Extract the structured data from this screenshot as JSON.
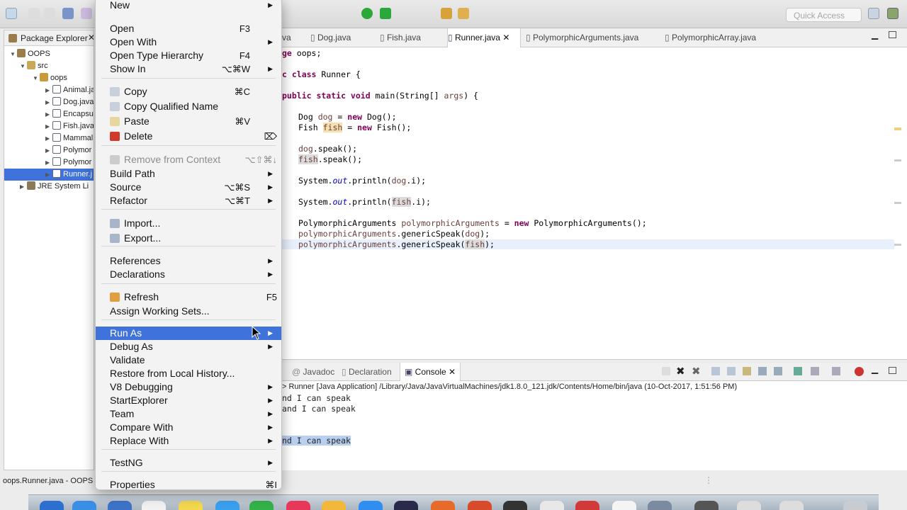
{
  "toolbar": {
    "quick_access_placeholder": "Quick Access"
  },
  "package_explorer": {
    "title": "Package Explorer",
    "tree": [
      {
        "label": "OOPS",
        "indent": 0,
        "kind": "project"
      },
      {
        "label": "src",
        "indent": 1,
        "kind": "folder"
      },
      {
        "label": "oops",
        "indent": 2,
        "kind": "package"
      },
      {
        "label": "Animal.ja",
        "indent": 3,
        "kind": "java"
      },
      {
        "label": "Dog.java",
        "indent": 3,
        "kind": "java"
      },
      {
        "label": "Encapsu",
        "indent": 3,
        "kind": "java"
      },
      {
        "label": "Fish.java",
        "indent": 3,
        "kind": "java"
      },
      {
        "label": "Mammal",
        "indent": 3,
        "kind": "java"
      },
      {
        "label": "Polymor",
        "indent": 3,
        "kind": "java"
      },
      {
        "label": "Polymor",
        "indent": 3,
        "kind": "java"
      },
      {
        "label": "Runner.j",
        "indent": 3,
        "kind": "java",
        "selected": true
      },
      {
        "label": "JRE System Li",
        "indent": 1,
        "kind": "library"
      }
    ]
  },
  "editor": {
    "tabs": [
      "va",
      "Dog.java",
      "Fish.java",
      "Runner.java",
      "PolymorphicArguments.java",
      "PolymorphicArray.java"
    ],
    "active_tab": "Runner.java",
    "lines": {
      "l1a": "ge ",
      "l1b": "oops;",
      "l2a": "c class",
      "l2b": " Runner {",
      "l3a": "public static void",
      "l3b": " main(String[] ",
      "l3c": "args",
      "l3d": ") {",
      "l4a": "Dog ",
      "l4b": "dog",
      "l4c": " = ",
      "l4d": "new",
      "l4e": " Dog();",
      "l5a": "Fish ",
      "l5b": "fish",
      "l5c": " = ",
      "l5d": "new",
      "l5e": " Fish();",
      "l6a": "dog",
      "l6b": ".speak();",
      "l7a": "fish",
      "l7b": ".speak();",
      "l8a": "System.",
      "l8b": "out",
      "l8c": ".println(",
      "l8d": "dog",
      "l8e": ".i);",
      "l9a": "System.",
      "l9b": "out",
      "l9c": ".println(",
      "l9d": "fish",
      "l9e": ".i);",
      "l10a": "PolymorphicArguments ",
      "l10b": "polymorphicArguments",
      "l10c": " = ",
      "l10d": "new",
      "l10e": " PolymorphicArguments();",
      "l11a": "polymorphicArguments",
      "l11b": ".genericSpeak(",
      "l11c": "dog",
      "l11d": ");",
      "l12a": "polymorphicArguments",
      "l12b": ".genericSpeak(",
      "l12c": "fish",
      "l12d": ");"
    }
  },
  "console": {
    "tabs": [
      "Javadoc",
      "Declaration",
      "Console"
    ],
    "header": "> Runner [Java Application] /Library/Java/JavaVirtualMachines/jdk1.8.0_121.jdk/Contents/Home/bin/java (10-Oct-2017, 1:51:56 PM)",
    "lines": [
      "nd I can speak",
      "and I can speak",
      "nd I can speak"
    ]
  },
  "status": {
    "text": "oops.Runner.java - OOPS"
  },
  "context_menu": {
    "items": {
      "new": {
        "label": "New"
      },
      "open": {
        "label": "Open",
        "shortcut": "F3"
      },
      "open_with": {
        "label": "Open With"
      },
      "open_type_hierarchy": {
        "label": "Open Type Hierarchy",
        "shortcut": "F4"
      },
      "show_in": {
        "label": "Show In",
        "shortcut": "⌥⌘W"
      },
      "copy": {
        "label": "Copy",
        "shortcut": "⌘C"
      },
      "copy_qualified": {
        "label": "Copy Qualified Name"
      },
      "paste": {
        "label": "Paste",
        "shortcut": "⌘V"
      },
      "delete": {
        "label": "Delete",
        "shortcut": "⌦"
      },
      "remove_context": {
        "label": "Remove from Context",
        "shortcut": "⌥⇧⌘↓"
      },
      "build_path": {
        "label": "Build Path"
      },
      "source": {
        "label": "Source",
        "shortcut": "⌥⌘S"
      },
      "refactor": {
        "label": "Refactor",
        "shortcut": "⌥⌘T"
      },
      "import": {
        "label": "Import..."
      },
      "export": {
        "label": "Export..."
      },
      "references": {
        "label": "References"
      },
      "declarations": {
        "label": "Declarations"
      },
      "refresh": {
        "label": "Refresh",
        "shortcut": "F5"
      },
      "assign_working_sets": {
        "label": "Assign Working Sets..."
      },
      "run_as": {
        "label": "Run As"
      },
      "debug_as": {
        "label": "Debug As"
      },
      "validate": {
        "label": "Validate"
      },
      "restore_history": {
        "label": "Restore from Local History..."
      },
      "v8_debugging": {
        "label": "V8 Debugging"
      },
      "start_explorer": {
        "label": "StartExplorer"
      },
      "team": {
        "label": "Team"
      },
      "compare_with": {
        "label": "Compare With"
      },
      "replace_with": {
        "label": "Replace With"
      },
      "testng": {
        "label": "TestNG"
      },
      "properties": {
        "label": "Properties",
        "shortcut": "⌘I"
      }
    }
  },
  "colors": {
    "selection": "#3f72da",
    "keyword": "#7f0055",
    "field": "#0000c0",
    "highlight": "#f7e0b0"
  }
}
